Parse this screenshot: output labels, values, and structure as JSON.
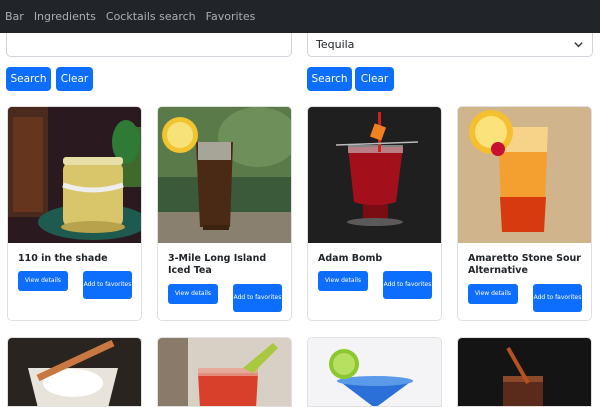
{
  "nav": {
    "items": [
      "Bar",
      "Ingredients",
      "Cocktails search",
      "Favorites"
    ]
  },
  "search": {
    "left_value": "",
    "select_value": "Tequila"
  },
  "buttons": {
    "search": "Search",
    "clear": "Clear"
  },
  "cards": [
    {
      "title": "110 in the shade",
      "view": "View details",
      "fav": "Add to favorites"
    },
    {
      "title": "3-Mile Long Island Iced Tea",
      "view": "View details",
      "fav": "Add to favorites"
    },
    {
      "title": "Adam Bomb",
      "view": "View details",
      "fav": "Add to favorites"
    },
    {
      "title": "Amaretto Stone Sour Alternative",
      "view": "View details",
      "fav": "Add to favorites"
    }
  ],
  "colors": {
    "navbar": "#212529",
    "primary": "#0d6efd"
  }
}
